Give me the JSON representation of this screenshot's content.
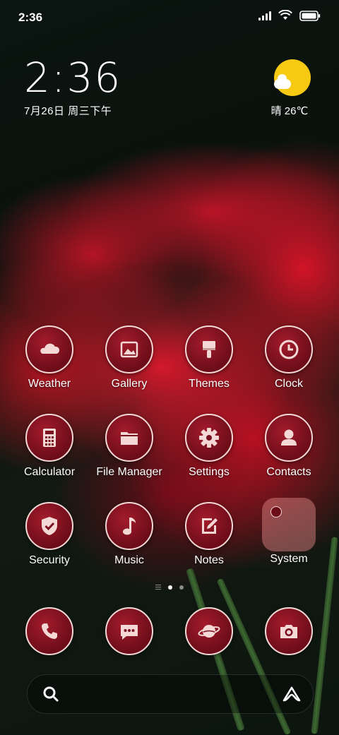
{
  "status_bar": {
    "time": "2:36"
  },
  "clock_widget": {
    "time": "2:36",
    "date": "7月26日 周三下午"
  },
  "weather_widget": {
    "text": "晴 26℃",
    "icon": "sunny-partly-cloudy-icon"
  },
  "apps": [
    {
      "label": "Weather",
      "icon": "weather-icon"
    },
    {
      "label": "Gallery",
      "icon": "gallery-icon"
    },
    {
      "label": "Themes",
      "icon": "paintbrush-icon"
    },
    {
      "label": "Clock",
      "icon": "clock-icon"
    },
    {
      "label": "Calculator",
      "icon": "calculator-icon"
    },
    {
      "label": "File Manager",
      "icon": "folder-icon"
    },
    {
      "label": "Settings",
      "icon": "gear-icon"
    },
    {
      "label": "Contacts",
      "icon": "person-icon"
    },
    {
      "label": "Security",
      "icon": "shield-icon"
    },
    {
      "label": "Music",
      "icon": "music-note-icon"
    },
    {
      "label": "Notes",
      "icon": "note-edit-icon"
    },
    {
      "label": "System",
      "icon": "folder-group-icon"
    }
  ],
  "page_indicator": {
    "pages": 2,
    "active": 1
  },
  "dock": [
    {
      "icon": "phone-icon"
    },
    {
      "icon": "message-icon"
    },
    {
      "icon": "browser-planet-icon"
    },
    {
      "icon": "camera-icon"
    }
  ],
  "search_bar": {
    "left_icon": "search-icon",
    "right_icon": "assistant-icon"
  },
  "colors": {
    "icon_fill": "#7a0f1e",
    "icon_ring": "#f3d8d6",
    "sun": "#f6c912"
  }
}
